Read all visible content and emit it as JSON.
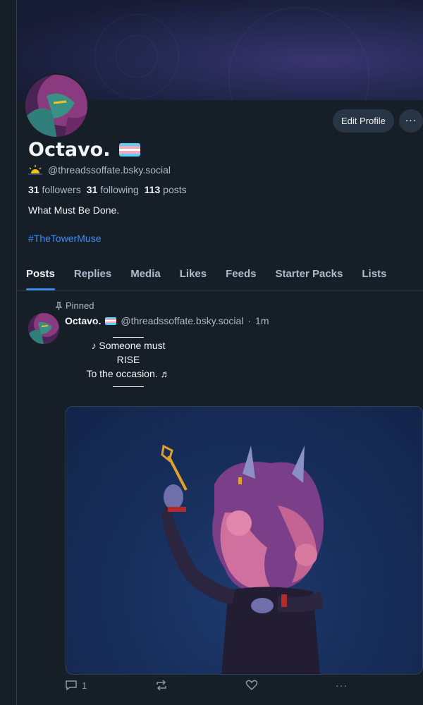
{
  "profile": {
    "display_name": "Octavo.",
    "handle": "@threadssoffate.bsky.social",
    "followers_count": "31",
    "followers_label": "followers",
    "following_count": "31",
    "following_label": "following",
    "posts_count": "113",
    "posts_label": "posts",
    "bio": "What Must Be Done.",
    "hashtag": "#TheTowerMuse",
    "edit_label": "Edit Profile",
    "more_label": "···"
  },
  "tabs": [
    {
      "label": "Posts",
      "active": true
    },
    {
      "label": "Replies"
    },
    {
      "label": "Media"
    },
    {
      "label": "Likes"
    },
    {
      "label": "Feeds"
    },
    {
      "label": "Starter Packs"
    },
    {
      "label": "Lists"
    }
  ],
  "post": {
    "pinned_label": "Pinned",
    "author": "Octavo.",
    "handle": "@threadssoffate.bsky.social",
    "separator": "·",
    "time": "1m",
    "lines": [
      "♪ Someone must",
      "RISE",
      "To the occasion. ♬"
    ],
    "reply_count": "1",
    "more_label": "···"
  },
  "colors": {
    "background": "#161e27",
    "accent": "#3b8ef0",
    "muted_text": "#aebbc9",
    "button_bg": "#273545"
  },
  "icons": {
    "status": "sun-icon",
    "pin": "pin-icon",
    "reply": "reply-icon",
    "repost": "repost-icon",
    "like": "heart-icon",
    "more": "more-icon"
  }
}
